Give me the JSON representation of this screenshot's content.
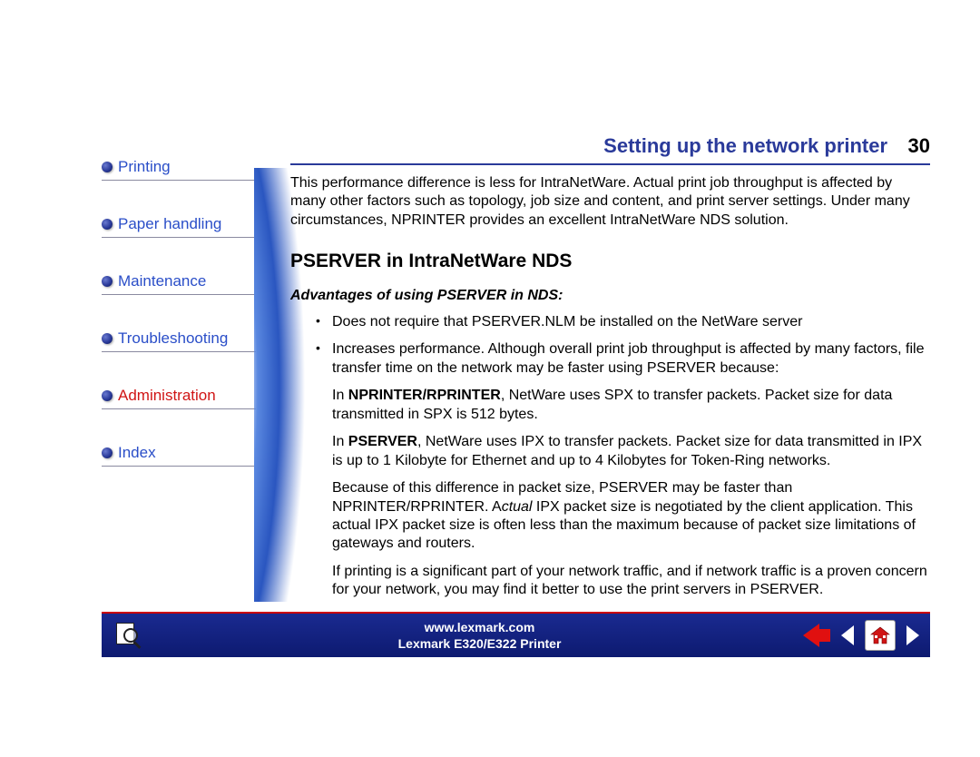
{
  "header": {
    "title": "Setting up the network printer",
    "page_number": "30"
  },
  "sidebar": {
    "items": [
      {
        "label": "Printing",
        "active": false
      },
      {
        "label": "Paper handling",
        "active": false
      },
      {
        "label": "Maintenance",
        "active": false
      },
      {
        "label": "Troubleshooting",
        "active": false
      },
      {
        "label": "Administration",
        "active": true
      },
      {
        "label": "Index",
        "active": false
      }
    ]
  },
  "content": {
    "intro": "This performance difference is less for IntraNetWare. Actual print job throughput is affected by many other factors such as topology, job size and content, and print server settings. Under many circumstances, NPRINTER provides an excellent IntraNetWare NDS solution.",
    "section_title": "PSERVER in IntraNetWare NDS",
    "subsection_title": "Advantages of using PSERVER in NDS:",
    "bullets": [
      "Does not require that PSERVER.NLM be installed on the NetWare server",
      "Increases performance. Although overall print job throughput is affected by many factors, file transfer time on the network may be faster using PSERVER because:"
    ],
    "sub1_pre": "In ",
    "sub1_b": "NPRINTER/RPRINTER",
    "sub1_post": ", NetWare uses SPX to transfer packets. Packet size for data transmitted in SPX is 512 bytes.",
    "sub2_pre": "In ",
    "sub2_b": "PSERVER",
    "sub2_post": ", NetWare uses IPX to transfer packets. Packet size for data transmitted in IPX is up to 1 Kilobyte for Ethernet and up to 4 Kilobytes for Token-Ring networks.",
    "sub3_pre": "Because of this difference in packet size, PSERVER may be faster than NPRINTER/RPRINTER. A",
    "sub3_i": "ctual",
    "sub3_post": " IPX packet size is negotiated by the client application. This actual IPX packet size is often less than the maximum because of packet size limitations of gateways and routers.",
    "sub4": "If printing is a significant part of your network traffic, and if network traffic is a proven concern for your network, you may find it better to use the print servers in PSERVER."
  },
  "footer": {
    "url": "www.lexmark.com",
    "product": "Lexmark E320/E322 Printer"
  }
}
